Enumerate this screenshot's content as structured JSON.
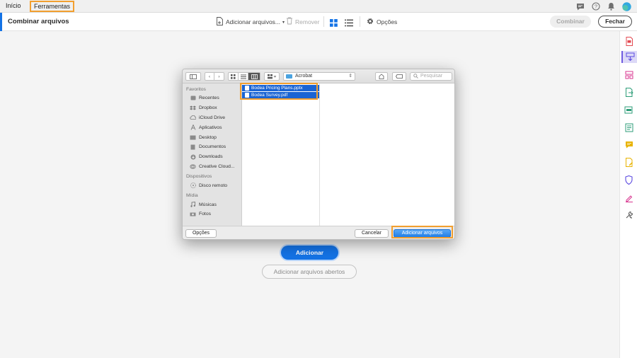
{
  "menubar": {
    "tabs": [
      {
        "label": "Início"
      },
      {
        "label": "Ferramentas"
      }
    ],
    "icons": [
      "chat-icon",
      "help-icon",
      "bell-icon",
      "avatar"
    ]
  },
  "toolbar": {
    "title": "Combinar arquivos",
    "add_label": "Adicionar arquivos...",
    "remove_label": "Remover",
    "options_label": "Opções",
    "combine_label": "Combinar",
    "close_label": "Fechar"
  },
  "rail": {
    "tools": [
      "create-pdf-icon",
      "combine-files-icon",
      "organize-pages-icon",
      "export-pdf-icon",
      "edit-pdf-icon",
      "scan-ocr-icon",
      "comment-icon",
      "fill-sign-icon",
      "protect-icon",
      "sign-icon",
      "more-tools-icon"
    ],
    "active": "combine-files-icon"
  },
  "dialog": {
    "location": "Acrobat",
    "search_placeholder": "Pesquisar",
    "sidebar": {
      "favorites_heading": "Favoritos",
      "favorites": [
        "Recentes",
        "Dropbox",
        "iCloud Drive",
        "Aplicativos",
        "Desktop",
        "Documentos",
        "Downloads",
        "Creative Cloud..."
      ],
      "devices_heading": "Dispositivos",
      "devices": [
        "Disco remoto"
      ],
      "media_heading": "Mídia",
      "media": [
        "Músicas",
        "Fotos"
      ]
    },
    "files": [
      "Bodea Pricing Plans.pptx",
      "Bodea Survey.pdf"
    ],
    "options_label": "Opções",
    "cancel_label": "Cancelar",
    "add_files_label": "Adicionar arquivos"
  },
  "main": {
    "add_label": "Adicionar",
    "add_open_files_label": "Adicionar arquivos abertos"
  },
  "colors": {
    "accent": "#1473e6",
    "highlight": "#f29f2f",
    "selection": "#1a64d3"
  }
}
